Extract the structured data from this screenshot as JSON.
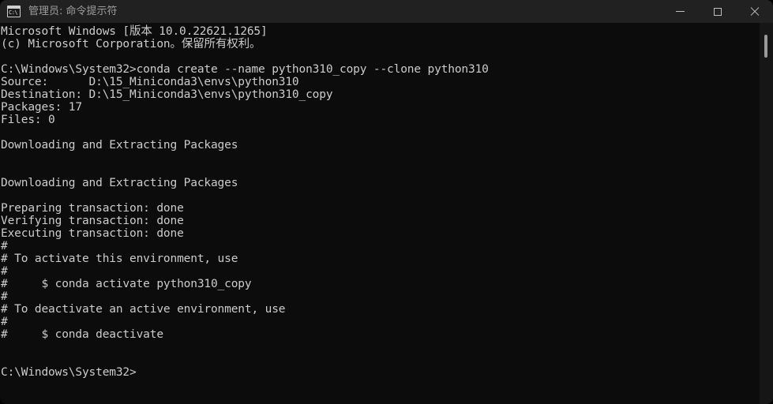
{
  "window": {
    "title": "管理员: 命令提示符",
    "icon_name": "console-icon",
    "icon_text": "C:\\",
    "background_color": "#0c0c0c",
    "titlebar_color": "#212121",
    "text_color": "#cccccc"
  },
  "controls": {
    "minimize_label": "—",
    "maximize_label": "□",
    "close_label": "✕"
  },
  "terminal": {
    "lines": [
      "Microsoft Windows [版本 10.0.22621.1265]",
      "(c) Microsoft Corporation。保留所有权利。",
      "",
      "C:\\Windows\\System32>conda create --name python310_copy --clone python310",
      "Source:      D:\\15_Miniconda3\\envs\\python310",
      "Destination: D:\\15_Miniconda3\\envs\\python310_copy",
      "Packages: 17",
      "Files: 0",
      "",
      "Downloading and Extracting Packages",
      "",
      "",
      "Downloading and Extracting Packages",
      "",
      "Preparing transaction: done",
      "Verifying transaction: done",
      "Executing transaction: done",
      "#",
      "# To activate this environment, use",
      "#",
      "#     $ conda activate python310_copy",
      "#",
      "# To deactivate an active environment, use",
      "#",
      "#     $ conda deactivate",
      "",
      "",
      "C:\\Windows\\System32>"
    ]
  },
  "scrollbar": {
    "thumb_name": "scrollbar-thumb"
  }
}
